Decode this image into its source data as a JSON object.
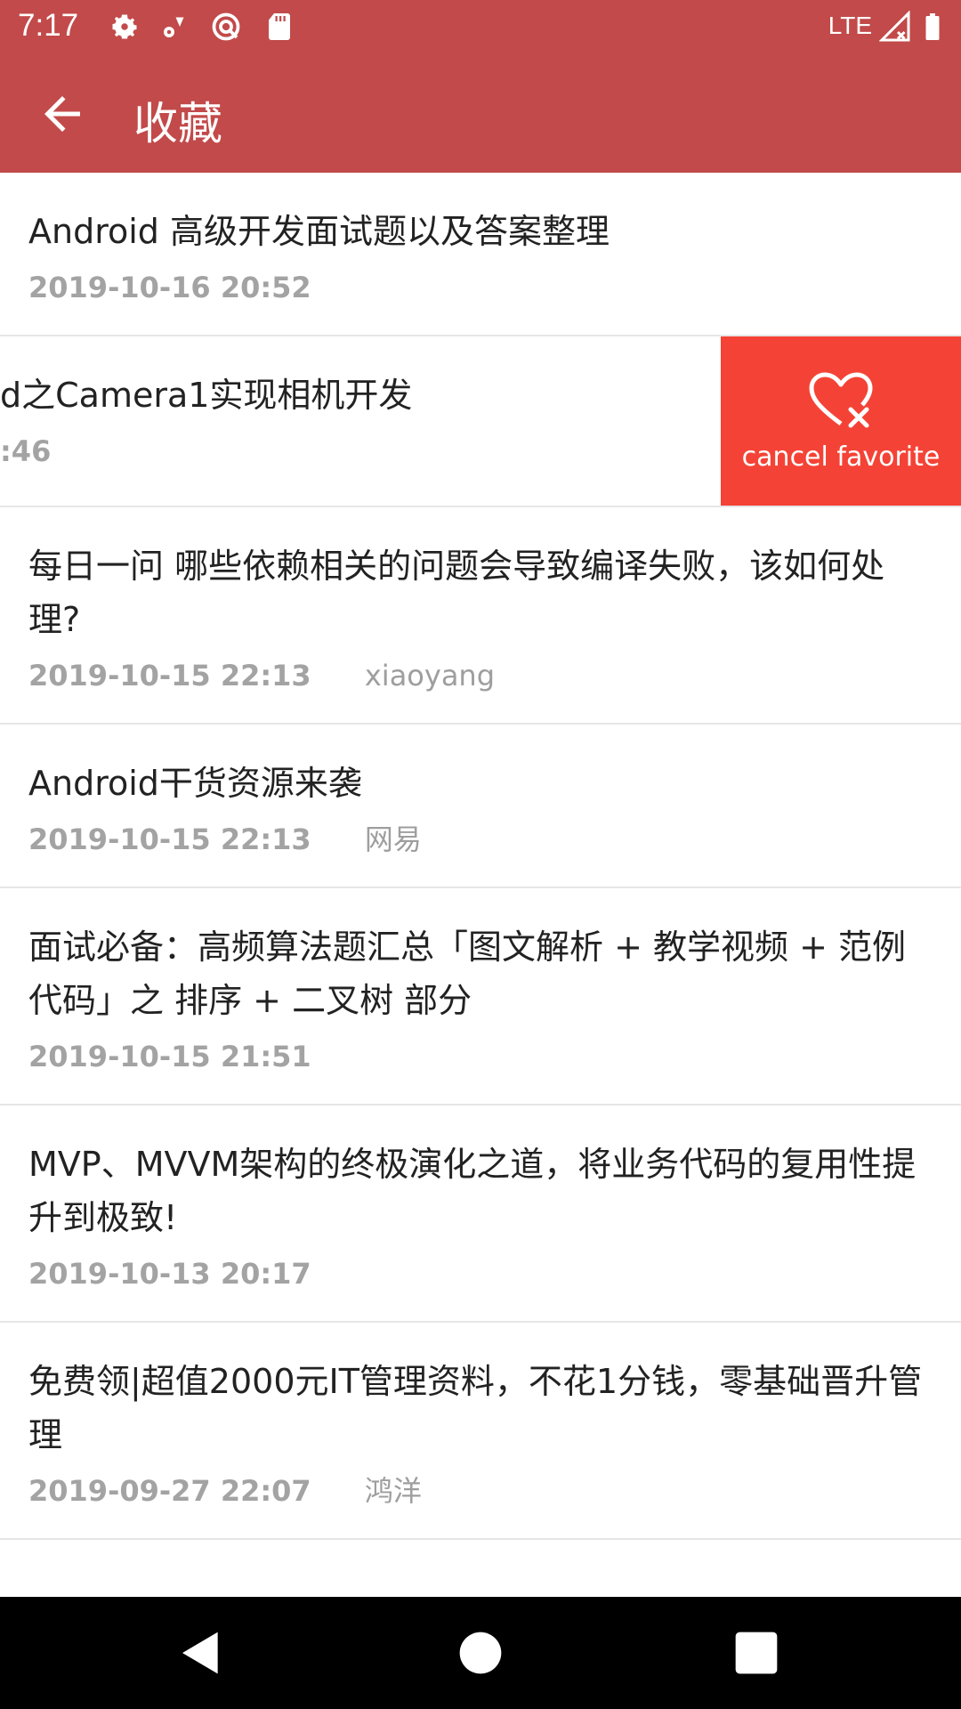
{
  "status_bar": {
    "time": "7:17",
    "network": "LTE",
    "icons": [
      "settings-icon",
      "location-icon",
      "vpn-icon",
      "sd-card-icon",
      "signal-icon",
      "battery-icon"
    ]
  },
  "app_bar": {
    "title": "收藏",
    "back_icon": "arrow-back-icon",
    "color": "#c24a4a"
  },
  "favorites": [
    {
      "title": "Android 高级开发面试题以及答案整理",
      "time": "2019-10-16 20:52",
      "author": ""
    },
    {
      "title": "d之Camera1实现相机开发",
      "time": ":46",
      "author": "",
      "swiped": true
    },
    {
      "title": "每日一问 哪些依赖相关的问题会导致编译失败，该如何处理?",
      "time": "2019-10-15 22:13",
      "author": "xiaoyang"
    },
    {
      "title": "Android干货资源来袭",
      "time": "2019-10-15 22:13",
      "author": "网易"
    },
    {
      "title": "面试必备：高频算法题汇总「图文解析 + 教学视频 + 范例代码」之 排序 + 二叉树 部分",
      "time": "2019-10-15 21:51",
      "author": ""
    },
    {
      "title": "MVP、MVVM架构的终极演化之道，将业务代码的复用性提升到极致!",
      "time": "2019-10-13 20:17",
      "author": ""
    },
    {
      "title": "免费领|超值2000元IT管理资料，不花1分钱，零基础晋升管理",
      "time": "2019-09-27 22:07",
      "author": "鸿洋"
    }
  ],
  "swipe_action": {
    "label": "cancel favorite",
    "icon": "heart-remove-icon",
    "color": "#f44336"
  },
  "nav_bar": {
    "buttons": [
      "back-triangle-icon",
      "home-circle-icon",
      "recents-square-icon"
    ]
  }
}
